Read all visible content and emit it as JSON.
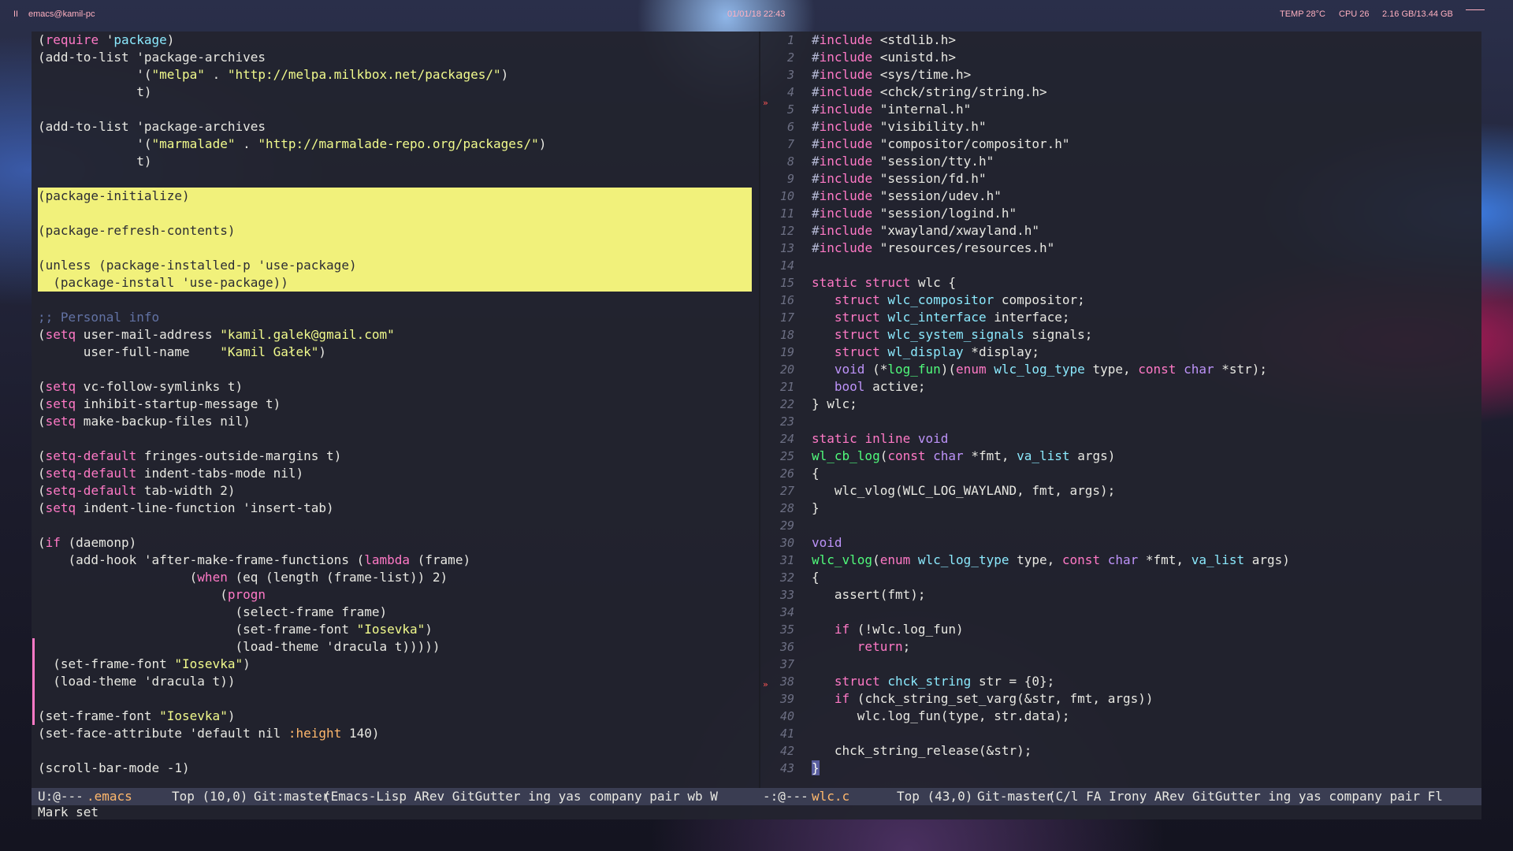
{
  "topbar": {
    "workspace": "II",
    "window_title": "emacs@kamil-pc",
    "clock": "01/01/18 22:43",
    "temp": "TEMP 28°C",
    "cpu": "CPU 26",
    "memory": "2.16 GB/13.44 GB"
  },
  "left_buffer": {
    "lines": [
      "(require 'package)",
      "(add-to-list 'package-archives",
      "             '(\"melpa\" . \"http://melpa.milkbox.net/packages/\")",
      "             t)",
      "",
      "(add-to-list 'package-archives",
      "             '(\"marmalade\" . \"http://marmalade-repo.org/packages/\")",
      "             t)",
      "",
      "(package-initialize)",
      "",
      "(package-refresh-contents)",
      "",
      "(unless (package-installed-p 'use-package)",
      "  (package-install 'use-package))",
      "",
      ";; Personal info",
      "(setq user-mail-address \"kamil.galek@gmail.com\"",
      "      user-full-name    \"Kamil Gałek\")",
      "",
      "(setq vc-follow-symlinks t)",
      "(setq inhibit-startup-message t)",
      "(setq make-backup-files nil)",
      "",
      "(setq-default fringes-outside-margins t)",
      "(setq-default indent-tabs-mode nil)",
      "(setq-default tab-width 2)",
      "(setq indent-line-function 'insert-tab)",
      "",
      "(if (daemonp)",
      "    (add-hook 'after-make-frame-functions (lambda (frame)",
      "                    (when (eq (length (frame-list)) 2)",
      "                        (progn",
      "                          (select-frame frame)",
      "                          (set-frame-font \"Iosevka\")",
      "                          (load-theme 'dracula t)))))",
      "  (set-frame-font \"Iosevka\")",
      "  (load-theme 'dracula t))",
      "",
      "(set-frame-font \"Iosevka\")",
      "(set-face-attribute 'default nil :height 140)",
      "",
      "(scroll-bar-mode -1)"
    ]
  },
  "right_buffer": {
    "lines": [
      "#include <stdlib.h>",
      "#include <unistd.h>",
      "#include <sys/time.h>",
      "#include <chck/string/string.h>",
      "#include \"internal.h\"",
      "#include \"visibility.h\"",
      "#include \"compositor/compositor.h\"",
      "#include \"session/tty.h\"",
      "#include \"session/fd.h\"",
      "#include \"session/udev.h\"",
      "#include \"session/logind.h\"",
      "#include \"xwayland/xwayland.h\"",
      "#include \"resources/resources.h\"",
      "",
      "static struct wlc {",
      "   struct wlc_compositor compositor;",
      "   struct wlc_interface interface;",
      "   struct wlc_system_signals signals;",
      "   struct wl_display *display;",
      "   void (*log_fun)(enum wlc_log_type type, const char *str);",
      "   bool active;",
      "} wlc;",
      "",
      "static inline void",
      "wl_cb_log(const char *fmt, va_list args)",
      "{",
      "   wlc_vlog(WLC_LOG_WAYLAND, fmt, args);",
      "}",
      "",
      "void",
      "wlc_vlog(enum wlc_log_type type, const char *fmt, va_list args)",
      "{",
      "   assert(fmt);",
      "",
      "   if (!wlc.log_fun)",
      "      return;",
      "",
      "   struct chck_string str = {0};",
      "   if (chck_string_set_varg(&str, fmt, args))",
      "      wlc.log_fun(type, str.data);",
      "",
      "   chck_string_release(&str);",
      "}"
    ],
    "line_numbers": [
      "1",
      "2",
      "3",
      "4",
      "5",
      "6",
      "7",
      "8",
      "9",
      "10",
      "11",
      "12",
      "13",
      "14",
      "15",
      "16",
      "17",
      "18",
      "19",
      "20",
      "21",
      "22",
      "23",
      "24",
      "25",
      "26",
      "27",
      "28",
      "29",
      "30",
      "31",
      "32",
      "33",
      "34",
      "35",
      "36",
      "37",
      "38",
      "39",
      "40",
      "41",
      "42",
      "43"
    ],
    "markers": [
      "»",
      "»"
    ]
  },
  "left_modeline": {
    "state": "U:@---",
    "buffer": ".emacs",
    "position": "Top (10,0)",
    "vc": "Git:master",
    "modes": "(Emacs-Lisp ARev GitGutter ing yas company pair wb W"
  },
  "right_modeline": {
    "state": "-:@---",
    "buffer": "wlc.c",
    "position": "Top (43,0)",
    "vc": "Git-master",
    "modes": "(C/l FA Irony ARev GitGutter ing yas company pair Fl"
  },
  "echo_area": "Mark set",
  "colors": {
    "background": "#22242e",
    "region": "#f1f17b",
    "keyword": "#ff79c6",
    "string": "#f1fa8c",
    "type": "#8be9fd",
    "function": "#50fa7b",
    "comment": "#6272a4",
    "modeline": "#3a3d52"
  }
}
